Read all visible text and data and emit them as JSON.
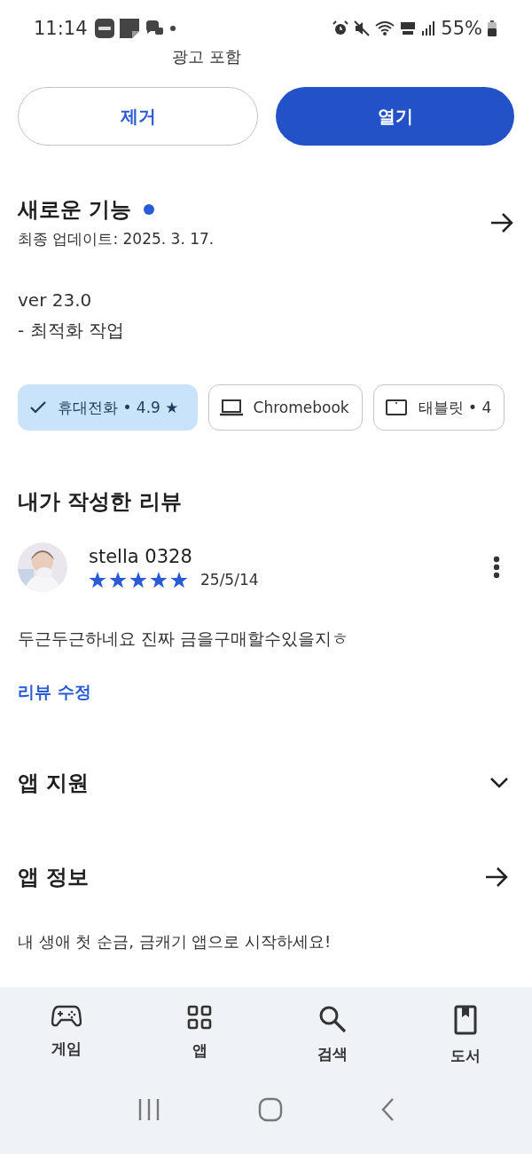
{
  "status_bar": {
    "time": "11:14",
    "battery": "55%"
  },
  "ad_notice": "광고 포함",
  "actions": [
    {
      "label": "제거",
      "kind": "outline"
    },
    {
      "label": "열기",
      "kind": "filled"
    }
  ],
  "whats_new": {
    "title": "새로운 기능",
    "updated": "최종 업데이트: 2025. 3. 17.",
    "lines": [
      "ver 23.0",
      "- 최적화 작업"
    ]
  },
  "devices": [
    {
      "label": "휴대전화 • 4.9 ★",
      "kind": "phone",
      "selected": true
    },
    {
      "label": "Chromebook",
      "kind": "laptop",
      "selected": false
    },
    {
      "label": "태블릿 • 4",
      "kind": "tablet",
      "selected": false
    }
  ],
  "my_review": {
    "title": "내가 작성한 리뷰",
    "user": "stella 0328",
    "stars": 5,
    "date": "25/5/14",
    "text": "두근두근하네요 진짜 금을구매할수있을지ㅎ",
    "edit_link": "리뷰 수정"
  },
  "sections": [
    {
      "title": "앱 지원",
      "kind": "expand"
    },
    {
      "title": "앱 정보",
      "kind": "arrow"
    }
  ],
  "app_info_text": "내 생애 첫 순금, 금캐기 앱으로 시작하세요!",
  "bottom_nav": [
    {
      "label": "게임",
      "kind": "games"
    },
    {
      "label": "앱",
      "kind": "apps"
    },
    {
      "label": "검색",
      "kind": "search"
    },
    {
      "label": "도서",
      "kind": "books"
    }
  ]
}
